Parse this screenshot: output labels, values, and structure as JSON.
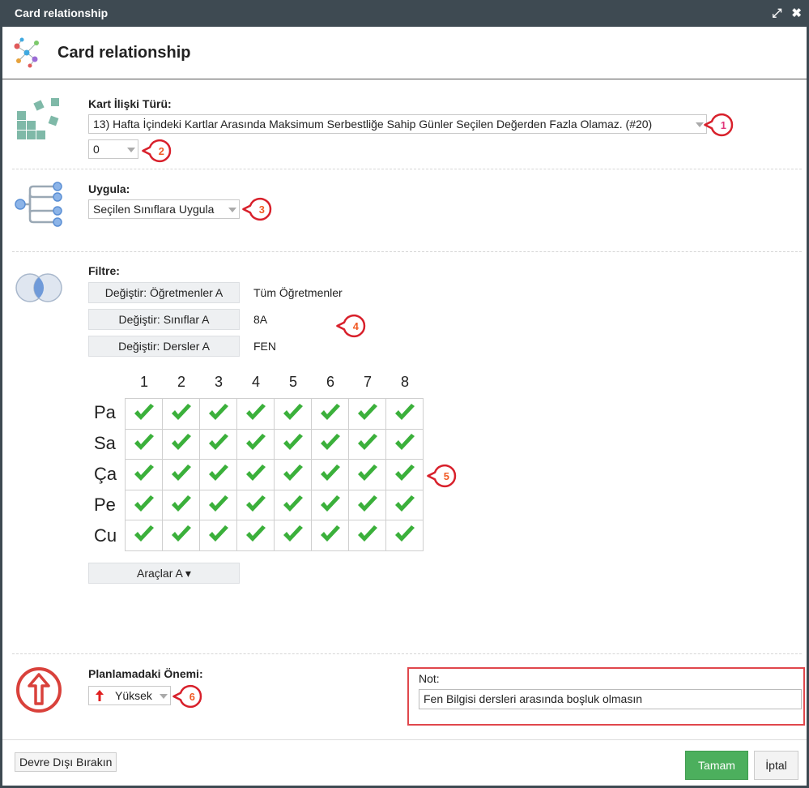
{
  "window": {
    "title": "Card relationship",
    "controls": {
      "maximize": "⤢",
      "close": "✖"
    }
  },
  "header": {
    "title": "Card relationship"
  },
  "relation_type": {
    "label": "Kart İlişki Türü:",
    "selected": "13) Hafta İçindeki Kartlar Arasında Maksimum Serbestliğe Sahip Günler Seçilen Değerden Fazla Olamaz. (#20)",
    "value_select": "0"
  },
  "apply": {
    "label": "Uygula:",
    "selected": "Seçilen Sınıflara Uygula"
  },
  "filter": {
    "label": "Filtre:",
    "rows": [
      {
        "button": "Değiştir: Öğretmenler A",
        "value": "Tüm Öğretmenler"
      },
      {
        "button": "Değiştir: Sınıflar A",
        "value": "8A"
      },
      {
        "button": "Değiştir: Dersler A",
        "value": "FEN"
      }
    ]
  },
  "grid": {
    "columns": [
      "1",
      "2",
      "3",
      "4",
      "5",
      "6",
      "7",
      "8"
    ],
    "rows": [
      "Pa",
      "Sa",
      "Ça",
      "Pe",
      "Cu"
    ],
    "check_color": "#3bb03b"
  },
  "tools_button": "Araçlar A ▾",
  "importance": {
    "label": "Planlamadaki Önemi:",
    "selected": "Yüksek",
    "accent": "#d9413b"
  },
  "note": {
    "label": "Not:",
    "value": "Fen Bilgisi dersleri arasında boşluk olmasın"
  },
  "callouts": [
    "1",
    "2",
    "3",
    "4",
    "5",
    "6"
  ],
  "footer": {
    "disable_label": "Devre Dışı Bırakın",
    "ok_label": "Tamam",
    "cancel_label": "İptal",
    "ok_color": "#4caf5d"
  }
}
